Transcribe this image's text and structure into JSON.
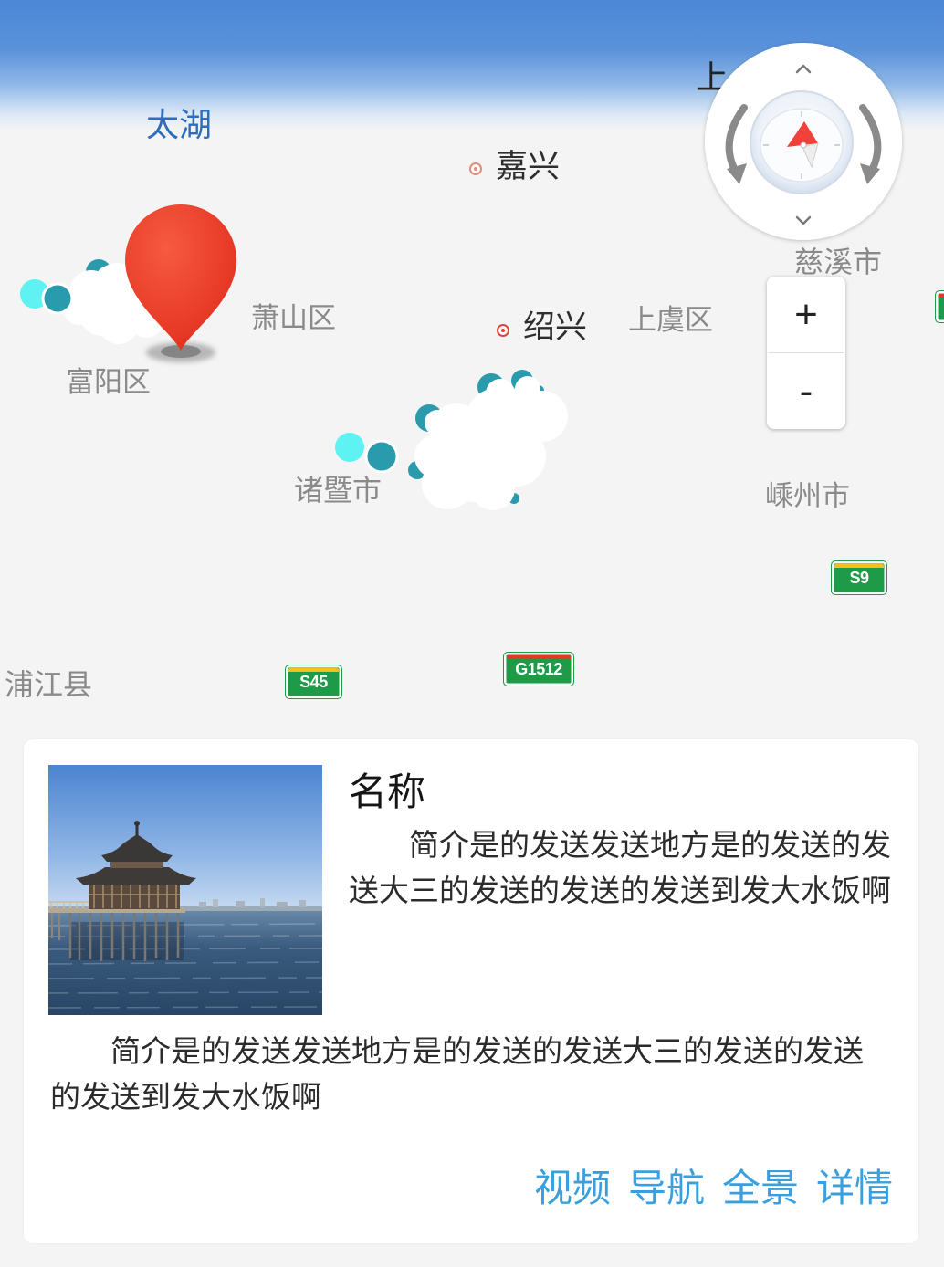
{
  "map": {
    "lake_label": "太湖",
    "city_labels": {
      "jiaxing": "嘉兴",
      "shaoxing": "绍兴",
      "partial": "上"
    },
    "district_labels": {
      "xiaoshan": "萧山区",
      "shangyu": "上虞区",
      "cixi": "慈溪市",
      "fuyang": "富阳区",
      "zhuji": "诸暨市",
      "shengzhou": "嵊州市",
      "pujiang": "浦江县"
    },
    "road_shields": [
      {
        "code": "S9",
        "stripe_color": "#f2c21b"
      },
      {
        "code": "S45",
        "stripe_color": "#f2c21b"
      },
      {
        "code": "G1512",
        "stripe_color": "#e0392a"
      }
    ],
    "marker": {
      "icon": "map-pin-icon",
      "color": "#e8392b"
    },
    "overlay_icons": [
      "cloud-icon",
      "dot-marker-icon"
    ]
  },
  "controls": {
    "compass": {
      "icon": "compass-icon",
      "rotate_left_icon": "rotate-left-icon",
      "rotate_right_icon": "rotate-right-icon",
      "tilt_up_icon": "chevron-up-icon",
      "tilt_down_icon": "chevron-down-icon"
    },
    "zoom_in_label": "+",
    "zoom_out_label": "-"
  },
  "card": {
    "title": "名称",
    "summary": "简介是的发送发送地方是的发送的发送大三的发送的发送的发送到发大水饭啊",
    "description": "简介是的发送发送地方是的发送的发送大三的发送的发送的发送到发大水饭啊",
    "actions": [
      {
        "label": "视频"
      },
      {
        "label": "导航"
      },
      {
        "label": "全景"
      },
      {
        "label": "详情"
      }
    ]
  },
  "colors": {
    "header": "#4b87d6",
    "map_background": "#f4f4f4",
    "action_text": "#3a9fdc",
    "highway_green": "#1f9a49",
    "lake_label": "#2f6cb9"
  }
}
